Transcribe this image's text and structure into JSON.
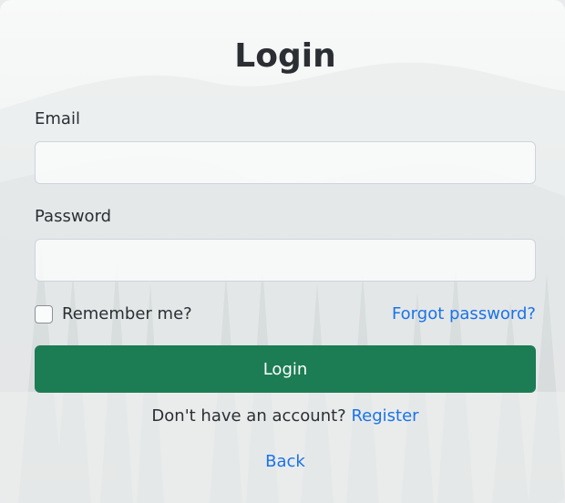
{
  "form": {
    "title": "Login",
    "email_label": "Email",
    "email_value": "",
    "password_label": "Password",
    "password_value": "",
    "remember_label": "Remember me?",
    "remember_checked": false,
    "forgot_label": "Forgot password?",
    "submit_label": "Login",
    "register_prompt": "Don't have an account?",
    "register_label": "Register",
    "back_label": "Back"
  },
  "colors": {
    "primary_button": "#1c7c54",
    "link": "#1a73e8",
    "text": "#2b2f33"
  }
}
